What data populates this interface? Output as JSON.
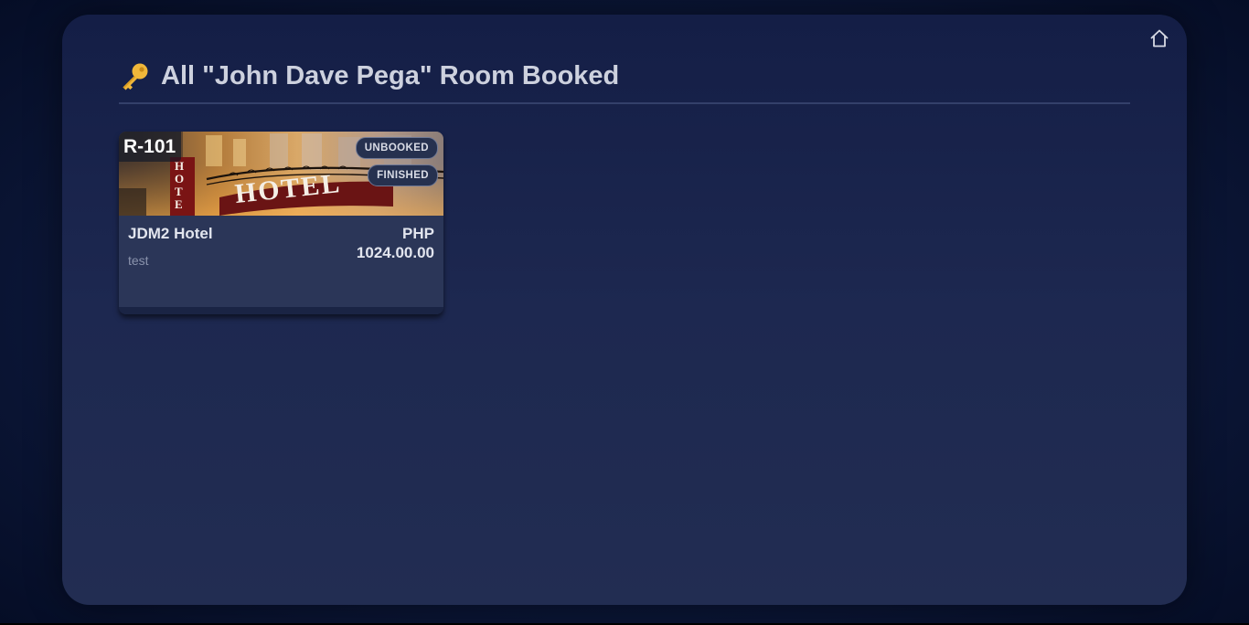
{
  "page": {
    "title": "All \"John Dave Pega\" Room Booked",
    "title_icon": "key-icon",
    "home_icon": "home-icon",
    "accent_color": "#f0b73a"
  },
  "rooms": [
    {
      "code": "R-101",
      "image_icon": "hotel-photo",
      "status_badges": [
        "UNBOOKED",
        "FINISHED"
      ],
      "hotel_name": "JDM2 Hotel",
      "description": "test",
      "currency": "PHP",
      "price": "1024.00.00"
    }
  ]
}
